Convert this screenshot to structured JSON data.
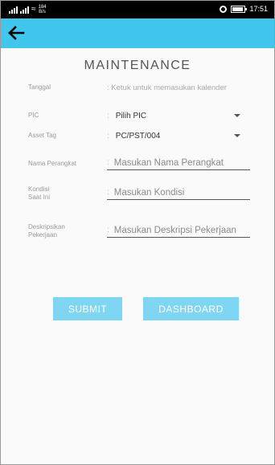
{
  "statusbar": {
    "net_speed_value": "184",
    "net_speed_unit": "B/s",
    "time": "17:51"
  },
  "header": {
    "back_icon": "arrow-left-icon",
    "accent_color": "#41c6ee"
  },
  "page": {
    "title": "MAINTENANCE"
  },
  "form": {
    "tanggal": {
      "label": "Tanggal",
      "value": ": Ketuk untuk memasukan kalender"
    },
    "pic": {
      "label": "PIC",
      "value": "Pilih PIC"
    },
    "asset_tag": {
      "label": "Asset Tag",
      "value": "PC/PST/004"
    },
    "nama_perangkat": {
      "label": "Nama Perangkat",
      "placeholder": "Masukan Nama Perangkat"
    },
    "kondisi": {
      "label": "Kondisi Saat Ini",
      "placeholder": "Masukan Kondisi"
    },
    "deskripsi": {
      "label": "Deskripsikan Pekerjaan",
      "placeholder": "Masukan Deskripsi Pekerjaan"
    }
  },
  "actions": {
    "submit_label": "SUBMIT",
    "dashboard_label": "DASHBOARD",
    "button_color": "#7fd6f2"
  }
}
